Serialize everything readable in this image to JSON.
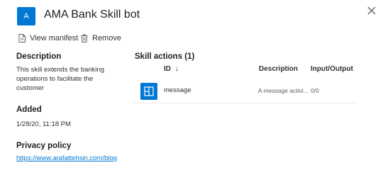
{
  "header": {
    "avatar_text": "A",
    "title": "AMA Bank Skill bot"
  },
  "toolbar": {
    "view_manifest": "View manifest",
    "remove": "Remove"
  },
  "details": {
    "description_heading": "Description",
    "description_text": "This skill extends the banking operations to facilitate the customer",
    "added_heading": "Added",
    "added_value": "1/28/20, 11:18 PM",
    "privacy_heading": "Privacy policy",
    "privacy_link": "https://www.arafattehsin.com/blog"
  },
  "actions": {
    "heading": "Skill actions (1)",
    "columns": {
      "id": "ID",
      "sort_arrow": "↓",
      "description": "Description",
      "io": "Input/Output"
    },
    "rows": [
      {
        "id": "message",
        "description": "A message activi...",
        "io": "0/0"
      }
    ]
  },
  "colors": {
    "accent": "#0078d4",
    "text": "#323130",
    "divider": "#edebe9"
  },
  "icons": {
    "close": "close-icon",
    "manifest": "document-icon",
    "remove": "trash-icon",
    "action": "message-card-icon"
  }
}
